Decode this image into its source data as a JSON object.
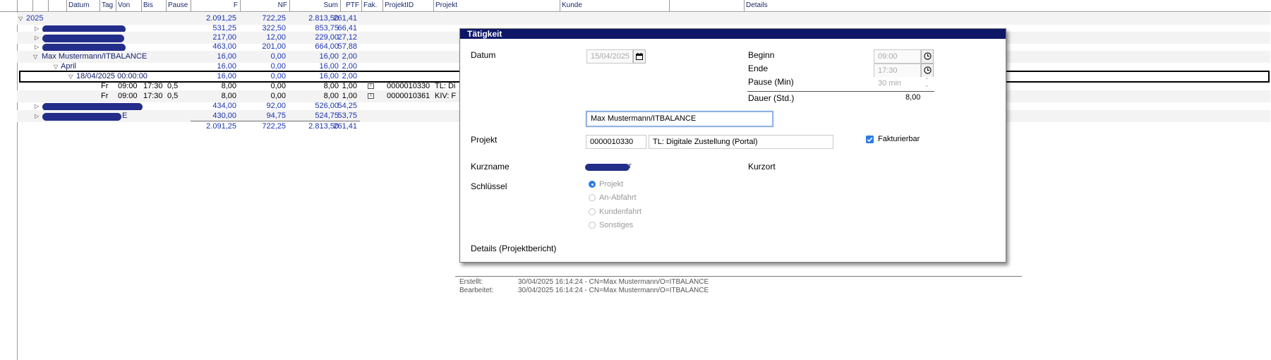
{
  "columns": {
    "datum": "Datum",
    "tag": "Tag",
    "von": "Von",
    "bis": "Bis",
    "pause": "Pause",
    "f": "F",
    "nf": "NF",
    "sum": "Sum",
    "ptf": "PTF",
    "fak": "Fak.",
    "projektid": "ProjektID",
    "projekt": "Projekt",
    "kunde": "Kunde",
    "details": "Details"
  },
  "tree": {
    "year": {
      "label": "2025",
      "f": "2.091,25",
      "nf": "722,25",
      "sum": "2.813,50",
      "ptf": "261,41"
    },
    "groups": [
      {
        "f": "531,25",
        "nf": "322,50",
        "sum": "853,75",
        "ptf": "66,41"
      },
      {
        "f": "217,00",
        "nf": "12,00",
        "sum": "229,00",
        "ptf": "27,12"
      },
      {
        "f": "463,00",
        "nf": "201,00",
        "sum": "664,00",
        "ptf": "57,88"
      }
    ],
    "person": {
      "label": "Max Mustermann/ITBALANCE",
      "f": "16,00",
      "nf": "0,00",
      "sum": "16,00",
      "ptf": "2,00"
    },
    "month": {
      "label": "April",
      "f": "16,00",
      "nf": "0,00",
      "sum": "16,00",
      "ptf": "2,00"
    },
    "day": {
      "label": "18/04/2025 00:00:00",
      "f": "16,00",
      "nf": "0,00",
      "sum": "16,00",
      "ptf": "2,00"
    },
    "entries": [
      {
        "tag": "Fr",
        "von": "09:00",
        "bis": "17:30",
        "pause": "0,5",
        "f": "8,00",
        "nf": "0,00",
        "sum": "8,00",
        "ptf": "1,00",
        "projektid": "0000010330",
        "projekt": "TL: Di"
      },
      {
        "tag": "Fr",
        "von": "09:00",
        "bis": "17:30",
        "pause": "0,5",
        "f": "8,00",
        "nf": "0,00",
        "sum": "8,00",
        "ptf": "1,00",
        "projektid": "0000010361",
        "projekt": "KIV: F"
      }
    ],
    "groups2": [
      {
        "f": "434,00",
        "nf": "92,00",
        "sum": "526,00",
        "ptf": "54,25",
        "suffix": ""
      },
      {
        "f": "430,00",
        "nf": "94,75",
        "sum": "524,75",
        "ptf": "53,75",
        "suffix": "E"
      }
    ],
    "total": {
      "f": "2.091,25",
      "nf": "722,25",
      "sum": "2.813,50",
      "ptf": "261,41"
    }
  },
  "dialog": {
    "title": "Tätigkeit",
    "datum_label": "Datum",
    "datum_value": "15/04/2025",
    "beginn_label": "Beginn",
    "beginn_value": "09:00",
    "ende_label": "Ende",
    "ende_value": "17:30",
    "pause_label": "Pause (Min)",
    "pause_value": "30 min",
    "dauer_label": "Dauer (Std.)",
    "dauer_value": "8,00",
    "person_value": "Max Mustermann/ITBALANCE",
    "projekt_label": "Projekt",
    "projekt_id": "0000010330",
    "projekt_name": "TL: Digitale Zustellung (Portal)",
    "fakturierbar_label": "Fakturierbar",
    "fakturierbar_checked": true,
    "kurzname_label": "Kurzname",
    "kurzname_suffix": "r",
    "kurzort_label": "Kurzort",
    "schluessel_label": "Schlüssel",
    "schluessel_options": [
      "Projekt",
      "An-Abfahrt",
      "Kundenfahrt",
      "Sonstiges"
    ],
    "schluessel_selected": "Projekt",
    "details_label": "Details (Projektbericht)"
  },
  "footer": {
    "erstellt_label": "Erstellt:",
    "erstellt_value": "30/04/2025 16:14:24 - CN=Max Mustermann/O=ITBALANCE",
    "bearbeitet_label": "Bearbeitet:",
    "bearbeitet_value": "30/04/2025 16:14:24 - CN=Max Mustermann/O=ITBALANCE"
  },
  "colors": {
    "accent": "#0e1667",
    "link_blue": "#1a33b0",
    "redaction": "#232d8a",
    "radio_blue": "#2a7be8"
  }
}
